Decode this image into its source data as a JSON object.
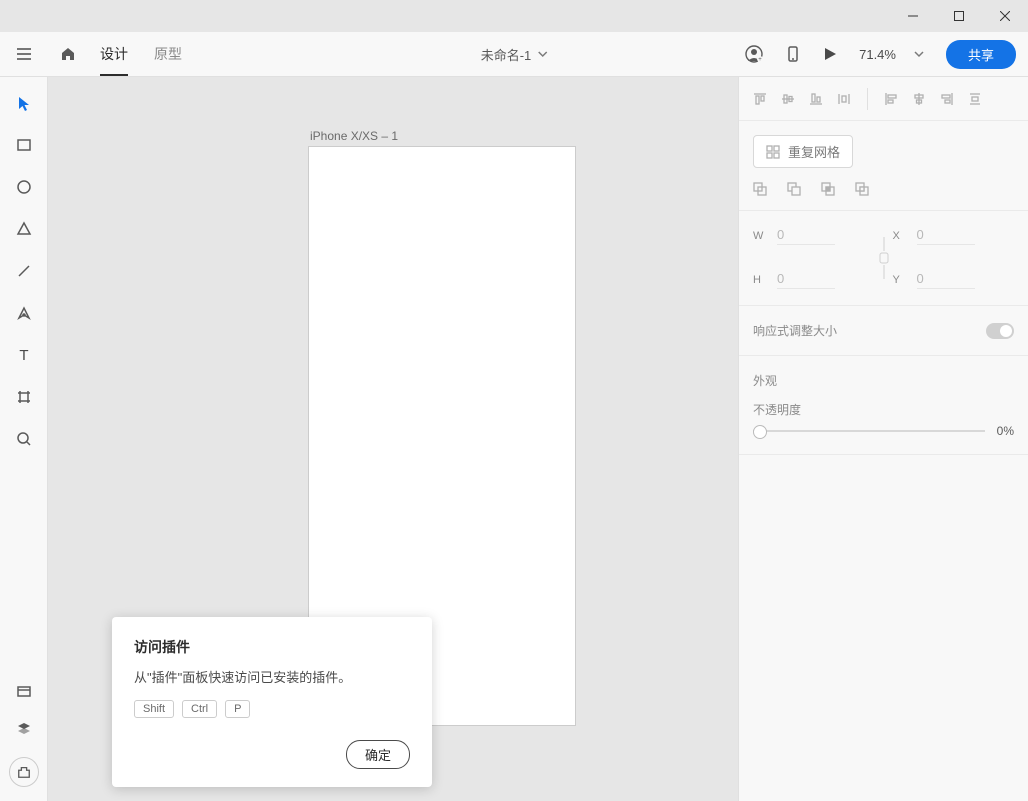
{
  "topbar": {
    "tab_design": "设计",
    "tab_prototype": "原型",
    "doc_title": "未命名-1",
    "zoom": "71.4%",
    "share": "共享"
  },
  "canvas": {
    "artboard_label": "iPhone X/XS – 1"
  },
  "popover": {
    "title": "访问插件",
    "body": "从\"插件\"面板快速访问已安装的插件。",
    "key1": "Shift",
    "key2": "Ctrl",
    "key3": "P",
    "ok": "确定"
  },
  "inspector": {
    "repeat_grid": "重复网格",
    "w_label": "W",
    "w_value": "0",
    "h_label": "H",
    "h_value": "0",
    "x_label": "X",
    "x_value": "0",
    "y_label": "Y",
    "y_value": "0",
    "responsive": "响应式调整大小",
    "appearance": "外观",
    "opacity_label": "不透明度",
    "opacity_value": "0%"
  }
}
